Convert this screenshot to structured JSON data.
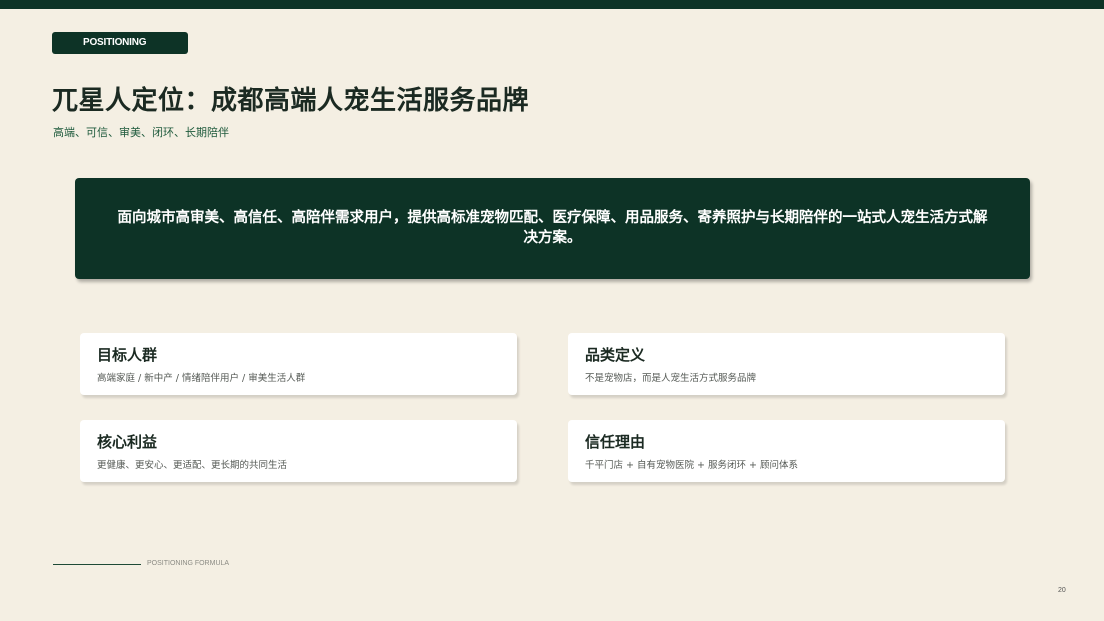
{
  "header": {
    "tag_label": "POSITIONING",
    "title": "兀星人定位：成都高端人宠生活服务品牌",
    "subtitle": "高端、可信、审美、闭环、长期陪伴"
  },
  "hero": {
    "statement": "面向城市高审美、高信任、高陪伴需求用户，提供高标准宠物匹配、医疗保障、用品服务、寄养照护与长期陪伴的一站式人宠生活方式解决方案。"
  },
  "cards": [
    {
      "title": "目标人群",
      "description": "高端家庭 / 新中产 / 情绪陪伴用户 / 审美生活人群"
    },
    {
      "title": "品类定义",
      "description": "不是宠物店，而是人宠生活方式服务品牌"
    },
    {
      "title": "核心利益",
      "description": "更健康、更安心、更适配、更长期的共同生活"
    },
    {
      "title": "信任理由",
      "description": "千平门店 + 自有宠物医院 + 服务闭环 + 顾问体系"
    }
  ],
  "footer": {
    "label": "POSITIONING FORMULA",
    "page_number": "20"
  },
  "colors": {
    "brand_dark_green": "#0d3326",
    "background": "#f4efe3",
    "accent_green_text": "#1e5a3c",
    "card_background": "#ffffff"
  }
}
